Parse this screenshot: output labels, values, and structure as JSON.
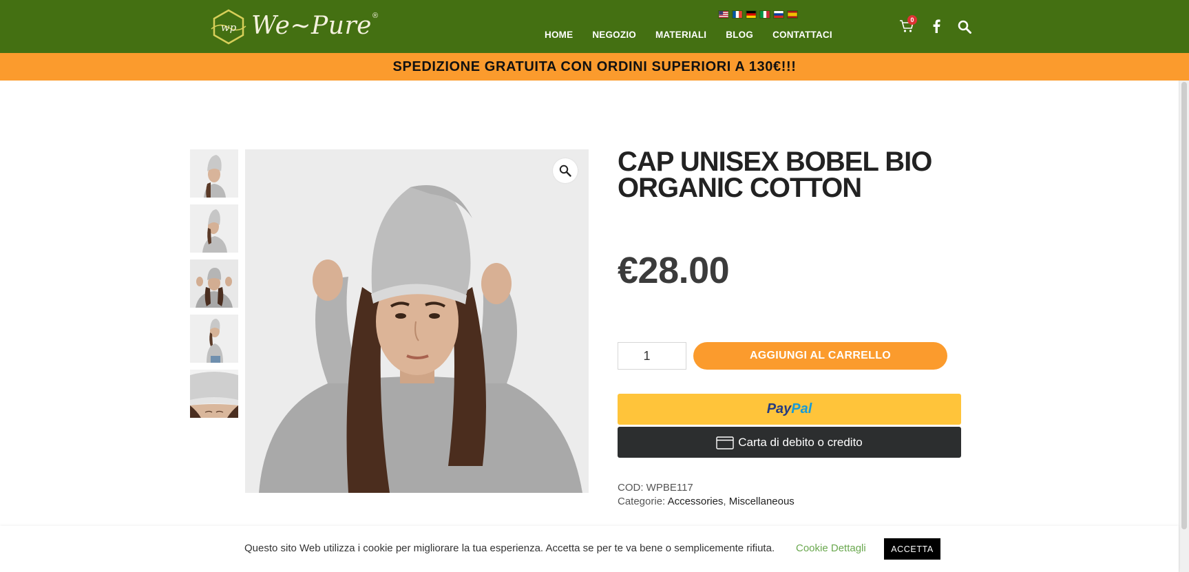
{
  "header": {
    "brand": "We~Pure",
    "brand_mark": "wp",
    "nav": [
      "HOME",
      "NEGOZIO",
      "MATERIALI",
      "BLOG",
      "CONTATTACI"
    ],
    "cart_count": "0",
    "languages": [
      "en",
      "fr",
      "de",
      "it",
      "ru",
      "es"
    ]
  },
  "banner": {
    "text": "SPEDIZIONE GRATUITA CON ORDINI SUPERIORI A 130€!!!"
  },
  "product": {
    "title": "CAP UNISEX BOBEL BIO ORGANIC COTTON",
    "price": "€28.00",
    "quantity": "1",
    "add_to_cart_label": "AGGIUNGI AL CARRELLO",
    "paypal_label": {
      "pay": "Pay",
      "pal": "Pal"
    },
    "card_label": "Carta di debito o credito",
    "sku_label": "COD:",
    "sku": "WPBE117",
    "categories_label": "Categorie:",
    "categories": [
      "Accessories",
      "Miscellaneous"
    ],
    "category_separator": ","
  },
  "gallery": {
    "thumbnail_count": 5,
    "selected_thumbnail": 3
  },
  "cookie": {
    "text": "Questo sito Web utilizza i cookie per migliorare la tua esperienza. Accetta se per te va bene o semplicemente rifiuta.",
    "details_link": "Cookie Dettagli",
    "accept_label": "ACCETTA"
  },
  "colors": {
    "header_green": "#447012",
    "accent_orange": "#fb9b2d",
    "paypal_yellow": "#ffc43a",
    "card_dark": "#2c2e2f",
    "cookie_link_green": "#6aa84f"
  }
}
